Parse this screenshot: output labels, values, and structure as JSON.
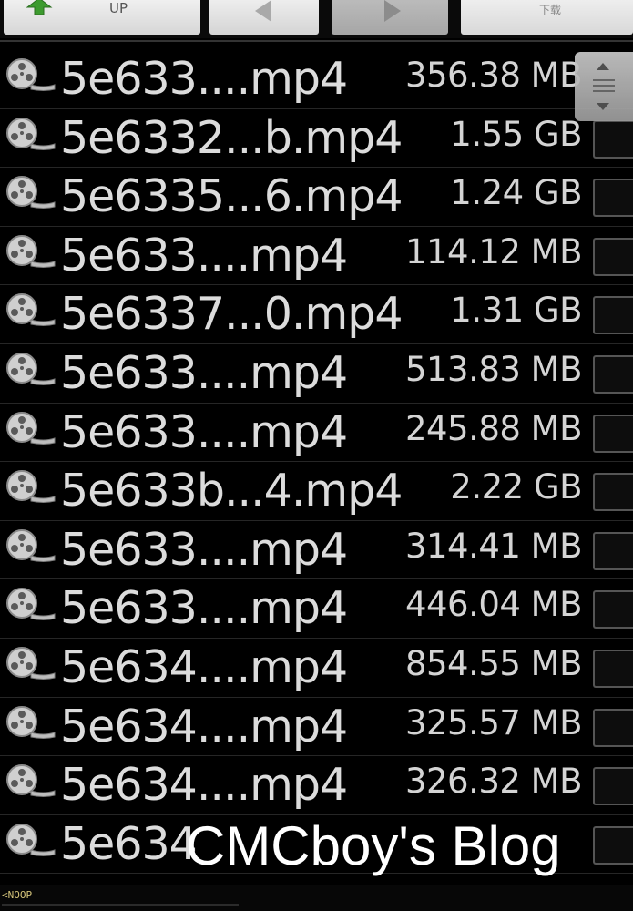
{
  "toolbar": {
    "up_label": "UP",
    "extra_label": "下载",
    "up_icon": "green-arrow-up-icon",
    "back_icon": "triangle-left-icon",
    "forward_icon": "triangle-right-icon"
  },
  "files": [
    {
      "name": "5e633....mp4",
      "size": "356.38 MB",
      "icon": "film-reel-icon"
    },
    {
      "name": "5e6332...b.mp4",
      "size": "1.55 GB",
      "icon": "film-reel-icon"
    },
    {
      "name": "5e6335...6.mp4",
      "size": "1.24 GB",
      "icon": "film-reel-icon"
    },
    {
      "name": "5e633....mp4",
      "size": "114.12 MB",
      "icon": "film-reel-icon"
    },
    {
      "name": "5e6337...0.mp4",
      "size": "1.31 GB",
      "icon": "film-reel-icon"
    },
    {
      "name": "5e633....mp4",
      "size": "513.83 MB",
      "icon": "film-reel-icon"
    },
    {
      "name": "5e633....mp4",
      "size": "245.88 MB",
      "icon": "film-reel-icon"
    },
    {
      "name": "5e633b...4.mp4",
      "size": "2.22 GB",
      "icon": "film-reel-icon"
    },
    {
      "name": "5e633....mp4",
      "size": "314.41 MB",
      "icon": "film-reel-icon"
    },
    {
      "name": "5e633....mp4",
      "size": "446.04 MB",
      "icon": "film-reel-icon"
    },
    {
      "name": "5e634....mp4",
      "size": "854.55 MB",
      "icon": "film-reel-icon"
    },
    {
      "name": "5e634....mp4",
      "size": "325.57 MB",
      "icon": "film-reel-icon"
    },
    {
      "name": "5e634....mp4",
      "size": "326.32 MB",
      "icon": "film-reel-icon"
    },
    {
      "name": "5e634",
      "size": "",
      "icon": "film-reel-icon"
    }
  ],
  "watermark": "CMCboy's Blog",
  "status": {
    "text": "<NOOP"
  },
  "colors": {
    "background": "#000000",
    "text": "#dcdcdc",
    "status_text": "#d4c37a"
  }
}
